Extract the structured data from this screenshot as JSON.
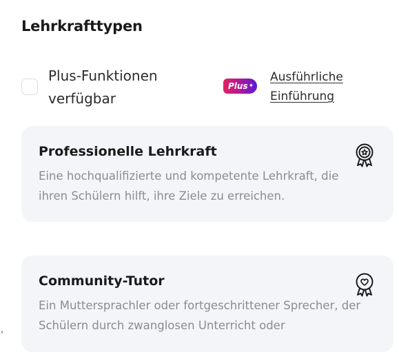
{
  "section": {
    "title": "Lehrkrafttypen"
  },
  "plus_filter": {
    "label": "Plus-Funktionen verfügbar",
    "badge": "Plus",
    "badge_spark": "✦",
    "intro_link": "Ausführliche Einführung",
    "checked": false
  },
  "teacher_types": [
    {
      "title": "Professionelle Lehrkraft",
      "description": "Eine hochqualifizierte und kompetente Lehrkraft, die ihren Schülern hilft, ihre Ziele zu erreichen.",
      "icon": "award-badge-star-icon"
    },
    {
      "title": "Community-Tutor",
      "description": "Ein Muttersprachler oder fortgeschrittener Sprecher, der Schülern durch zwanglosen Unterricht oder",
      "icon": "award-badge-heart-icon"
    }
  ],
  "colors": {
    "card_background": "#f4f5f8",
    "badge_gradient_start": "#e0245e",
    "badge_gradient_end": "#5a1ad6",
    "muted_text": "#8a8c94"
  },
  "edge_glyph": "‹"
}
